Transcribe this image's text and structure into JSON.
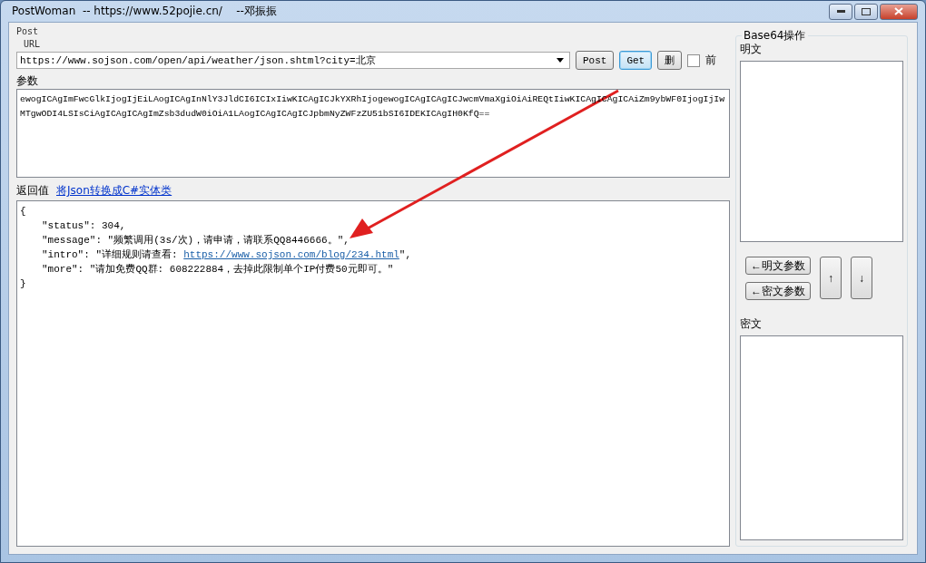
{
  "window": {
    "title": "PostWoman  -- https://www.52pojie.cn/    --邓振振"
  },
  "request": {
    "group_label": "Post",
    "url_label": "URL",
    "url": "https://www.sojson.com/open/api/weather/json.shtml?city=北京",
    "buttons": [
      {
        "label": "Post",
        "focused": false
      },
      {
        "label": "Get",
        "focused": true
      },
      {
        "label": "删",
        "focused": false
      }
    ],
    "checkbox": {
      "label": "前",
      "checked": false
    },
    "params_label": "参数",
    "params": "ewogICAgImFwcGlkIjogIjEiLAogICAgInNlY3JldCI6ICIxIiwKICAgICJkYXRhIjogewogICAgICAgICJwcmVmaXgiOiAiREQtIiwKICAgICAgICAiZm9ybWF0IjogIjIwMTgwODI4LSIsCiAgICAgICAgImZsb3dudW0iOiA1LAogICAgICAgICJpbmNyZWFzZU51bSI6IDEKICAgIH0KfQ=="
  },
  "response": {
    "label": "返回值",
    "link": "将Json转换成C#实体类",
    "open": "{",
    "entries": [
      [
        {
          "kind": "text",
          "text": "\"status\": 304,"
        }
      ],
      [
        {
          "kind": "text",
          "text": "\"message\": \"频繁调用(3s/次)，请申请，请联系QQ8446666。\","
        }
      ],
      [
        {
          "kind": "text",
          "text": "\"intro\": \"详细规则请查看: "
        },
        {
          "kind": "link",
          "text": "https://www.sojson.com/blog/234.html"
        },
        {
          "kind": "text",
          "text": "\","
        }
      ],
      [
        {
          "kind": "text",
          "text": "\"more\": \"请加免费QQ群: 608222884，去掉此限制单个IP付费50元即可。\""
        }
      ]
    ],
    "close": "}"
  },
  "base64": {
    "group_label": "Base64操作",
    "plain_label": "明文",
    "cipher_label": "密文",
    "buttons": [
      {
        "label": "←明文参数",
        "kind": "wide"
      },
      {
        "label": "←密文参数",
        "kind": "wide"
      },
      {
        "label": "↑",
        "kind": "tall"
      },
      {
        "label": "↓",
        "kind": "tall"
      }
    ]
  }
}
